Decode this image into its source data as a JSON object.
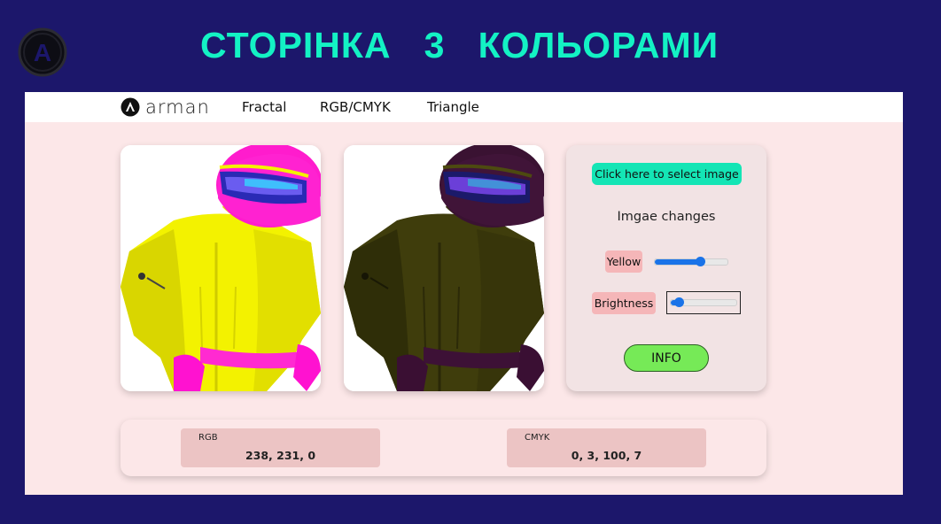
{
  "slide": {
    "title": "СТОРІНКА   3   КОЛЬОРАМИ",
    "logo_letter": "A"
  },
  "navbar": {
    "brand": "arman",
    "links": [
      "Fractal",
      "RGB/CMYK",
      "Triangle"
    ]
  },
  "images": {
    "original_alt": "racing driver with pink helmet and yellow suit",
    "modified_alt": "racing driver image with reduced yellow and brightness"
  },
  "controls": {
    "select_button": "Click here to select image",
    "section_title": "Imgae changes",
    "yellow_label": "Yellow",
    "yellow_value": 0.62,
    "brightness_label": "Brightness",
    "brightness_value": 0.12,
    "info_button": "INFO"
  },
  "values": {
    "rgb_label": "RGB",
    "rgb_value": "238, 231, 0",
    "cmyk_label": "CMYK",
    "cmyk_value": "0, 3, 100, 7"
  },
  "colors": {
    "slide_bg": "#1c176b",
    "title": "#13f2c4",
    "panel_bg": "#fce7e8",
    "accent_teal": "#14e5b5",
    "info_green": "#76ea57",
    "slider_blue": "#1a73e8",
    "label_pink": "#f5b6b8"
  }
}
